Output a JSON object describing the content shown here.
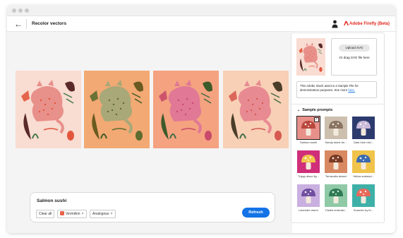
{
  "window": {
    "title": "Recolor vectors"
  },
  "header": {
    "back_icon": "arrow-left-icon",
    "title": "Recolor vectors",
    "user_icon": "user-icon",
    "brand": "Adobe Firefly (Beta)",
    "brand_color": "#e1251b"
  },
  "canvas": {
    "background": "#f4f4f4",
    "variations": [
      {
        "name": "variation-1",
        "bg": "#f9dcd2",
        "cat": "#e8908a",
        "accent": "#e2563d",
        "leaf": "#5a2a2a",
        "plant": "#3f7a45"
      },
      {
        "name": "variation-2",
        "bg": "#f2a974",
        "cat": "#a8a878",
        "accent": "#5d6b2f",
        "leaf": "#6a5a20",
        "plant": "#3d5a25"
      },
      {
        "name": "variation-3",
        "bg": "#f4a280",
        "cat": "#e07896",
        "accent": "#c94a6a",
        "leaf": "#3d5a2a",
        "plant": "#3f6d45"
      },
      {
        "name": "variation-4",
        "bg": "#f8d0b6",
        "cat": "#e88a92",
        "accent": "#d65a50",
        "leaf": "#4a3d2a",
        "plant": "#3f6d45"
      }
    ]
  },
  "prompt": {
    "text": "Salmon sushi",
    "clear_label": "Clear all",
    "chips": [
      {
        "label": "Vermilion",
        "color": "#e8644a"
      },
      {
        "label": "Analogous"
      }
    ],
    "refresh_label": "Refresh",
    "accent": "#1473e6"
  },
  "panel": {
    "upload_label": "Upload SVG",
    "drag_text": "Or drag SVG file here",
    "notice_text": "This Adobe Stock asset is a Sample File for demonstration purposes. See more ",
    "notice_link": "here.",
    "sample_heading": "Sample prompts",
    "samples": [
      {
        "label": "Salmon sushi",
        "bg": "#e8908a",
        "cap": "#b8473b",
        "selected": true
      },
      {
        "label": "Sandy stone be...",
        "bg": "#cdbfae",
        "cap": "#8a7360",
        "selected": false
      },
      {
        "label": "Dark blue mid...",
        "bg": "#2c3a6e",
        "cap": "#c9b9d8",
        "selected": false
      },
      {
        "label": "Trippy disco lig...",
        "bg": "#d02f7a",
        "cap": "#f2c54b",
        "selected": false
      },
      {
        "label": "Terracotta desert",
        "bg": "#d98962",
        "cap": "#7a3b24",
        "selected": false
      },
      {
        "label": "Yellow submari...",
        "bg": "#f0c34a",
        "cap": "#3a6ab0",
        "selected": false
      },
      {
        "label": "Lavender storm",
        "bg": "#c9b0e0",
        "cap": "#6f4fa0",
        "selected": false
      },
      {
        "label": "Faded emerald...",
        "bg": "#8fc9a6",
        "cap": "#2e7a55",
        "selected": false
      },
      {
        "label": "Summer by th...",
        "bg": "#3fb0a8",
        "cap": "#e86a5a",
        "selected": false
      }
    ]
  }
}
